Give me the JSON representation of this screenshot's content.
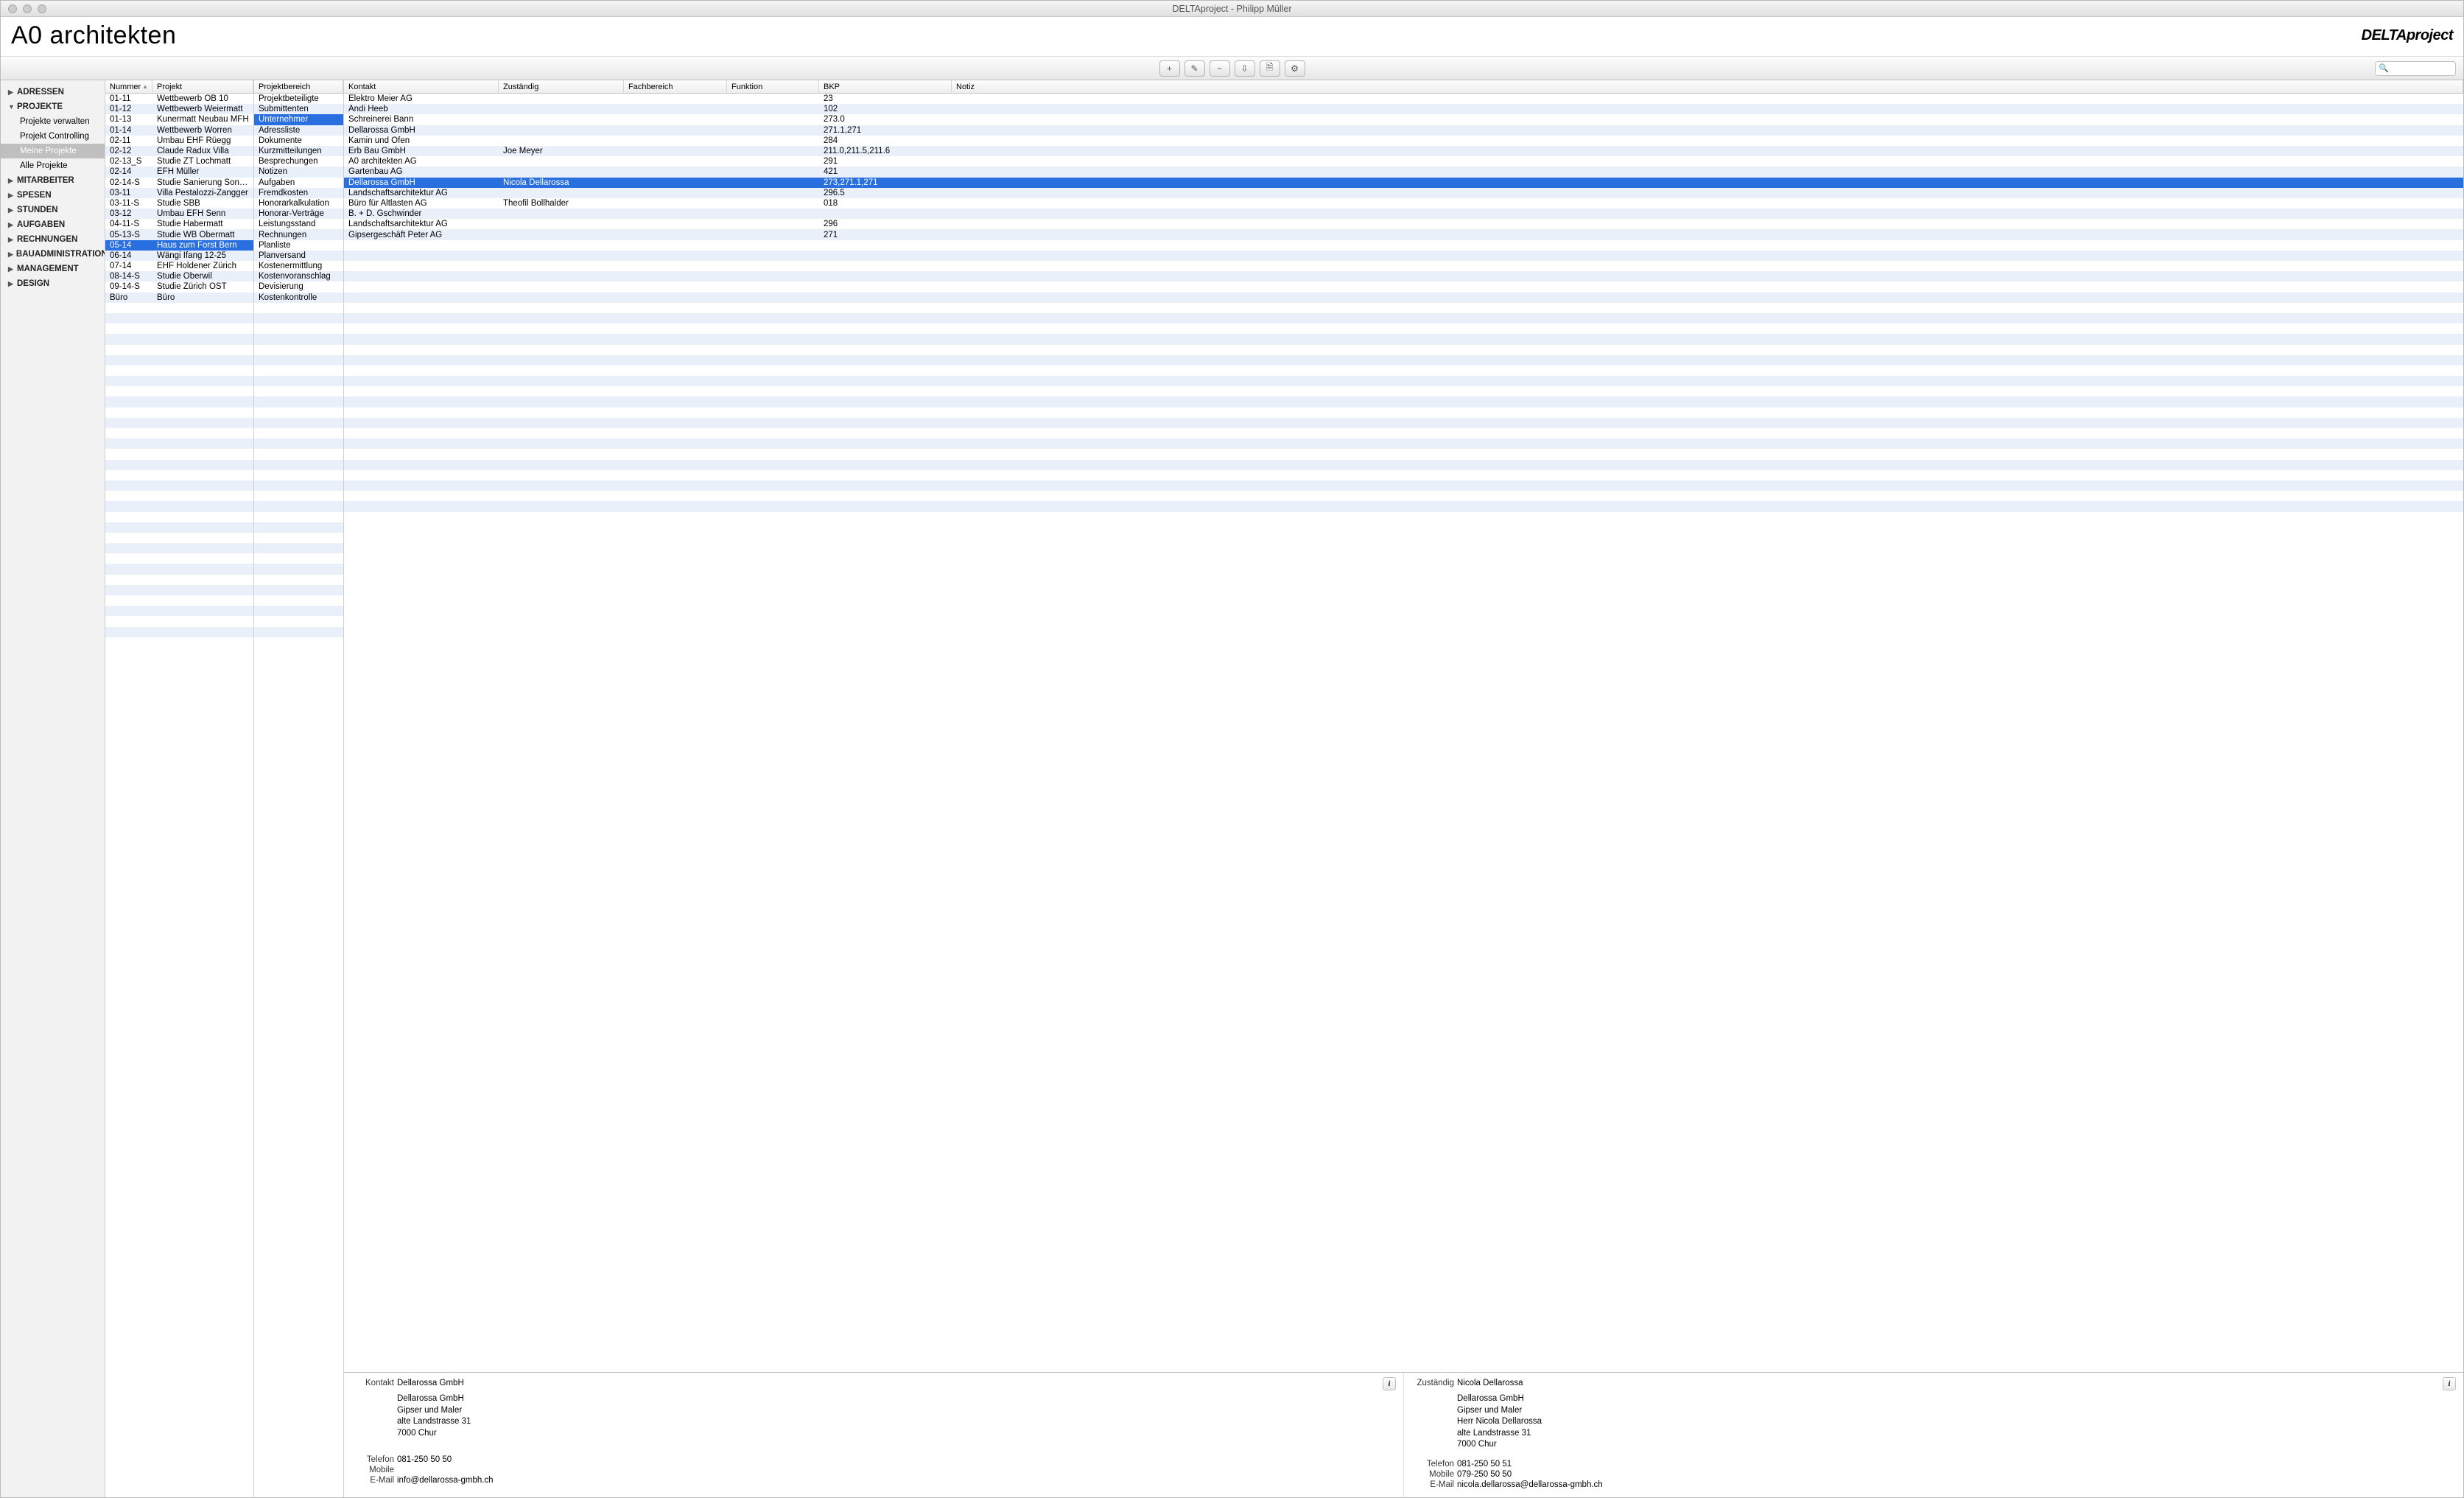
{
  "window_title": "DELTAproject - Philipp Müller",
  "header": {
    "brand": "A0 architekten",
    "logo": "DELTAproject"
  },
  "toolbar_icons": [
    "+",
    "✎",
    "−",
    "⇩",
    "🗎",
    "⚙"
  ],
  "search_placeholder": "",
  "sidebar": [
    {
      "label": "ADRESSEN",
      "open": false
    },
    {
      "label": "PROJEKTE",
      "open": true,
      "children": [
        {
          "label": "Projekte verwalten"
        },
        {
          "label": "Projekt Controlling"
        },
        {
          "label": "Meine Projekte",
          "selected": true
        },
        {
          "label": "Alle Projekte"
        }
      ]
    },
    {
      "label": "MITARBEITER",
      "open": false
    },
    {
      "label": "SPESEN",
      "open": false
    },
    {
      "label": "STUNDEN",
      "open": false
    },
    {
      "label": "AUFGABEN",
      "open": false
    },
    {
      "label": "RECHNUNGEN",
      "open": false
    },
    {
      "label": "BAUADMINISTRATION",
      "open": false
    },
    {
      "label": "MANAGEMENT",
      "open": false
    },
    {
      "label": "DESIGN",
      "open": false
    }
  ],
  "projects": {
    "headers": [
      "Nummer",
      "Projekt"
    ],
    "rows": [
      {
        "n": "01-11",
        "p": "Wettbewerb OB 10"
      },
      {
        "n": "01-12",
        "p": "Wettbewerb Weiermatt"
      },
      {
        "n": "01-13",
        "p": "Kunermatt Neubau MFH"
      },
      {
        "n": "01-14",
        "p": "Wettbewerb Worren"
      },
      {
        "n": "02-11",
        "p": "Umbau EHF Rüegg"
      },
      {
        "n": "02-12",
        "p": "Claude Radux Villa"
      },
      {
        "n": "02-13_S",
        "p": "Studie ZT Lochmatt"
      },
      {
        "n": "02-14",
        "p": "EFH Müller"
      },
      {
        "n": "02-14-S",
        "p": "Studie Sanierung Sonne..."
      },
      {
        "n": "03-11",
        "p": "Villa Pestalozzi-Zangger"
      },
      {
        "n": "03-11-S",
        "p": "Studie SBB"
      },
      {
        "n": "03-12",
        "p": "Umbau EFH Senn"
      },
      {
        "n": "04-11-S",
        "p": "Studie Habermatt"
      },
      {
        "n": "05-13-S",
        "p": "Studie WB Obermatt"
      },
      {
        "n": "05-14",
        "p": "Haus zum Forst Bern",
        "sel": true
      },
      {
        "n": "06-14",
        "p": "Wängi Ifang 12-25"
      },
      {
        "n": "07-14",
        "p": "EHF Holdener Zürich"
      },
      {
        "n": "08-14-S",
        "p": "Studie Oberwil"
      },
      {
        "n": "09-14-S",
        "p": "Studie Zürich OST"
      },
      {
        "n": "Büro",
        "p": "Büro"
      }
    ],
    "blank_rows": 32
  },
  "projbereich": {
    "header": "Projektbereich",
    "rows": [
      "Projektbeteiligte",
      "Submittenten",
      {
        "t": "Unternehmer",
        "sel": true
      },
      "Adressliste",
      "Dokumente",
      "Kurzmitteilungen",
      "Besprechungen",
      "Notizen",
      "Aufgaben",
      "Fremdkosten",
      "Honorarkalkulation",
      "Honorar-Verträge",
      "Leistungsstand",
      "Rechnungen",
      "Planliste",
      "Planversand",
      "Kostenermittlung",
      "Kostenvoranschlag",
      "Devisierung",
      "Kostenkontrolle"
    ],
    "blank_rows": 32
  },
  "contacts": {
    "headers": [
      "Kontakt",
      "Zuständig",
      "Fachbereich",
      "Funktion",
      "BKP",
      "Notiz"
    ],
    "col_widths": [
      "210px",
      "170px",
      "140px",
      "125px",
      "180px",
      "1fr"
    ],
    "rows": [
      {
        "k": "Elektro Meier AG",
        "z": "",
        "f": "",
        "fn": "",
        "b": "23"
      },
      {
        "k": "Andi Heeb",
        "z": "",
        "f": "",
        "fn": "",
        "b": "102"
      },
      {
        "k": "Schreinerei Bann",
        "z": "",
        "f": "",
        "fn": "",
        "b": "273.0"
      },
      {
        "k": "Dellarossa GmbH",
        "z": "",
        "f": "",
        "fn": "",
        "b": "271.1,271"
      },
      {
        "k": "Kamin und Ofen",
        "z": "",
        "f": "",
        "fn": "",
        "b": "284"
      },
      {
        "k": "Erb Bau GmbH",
        "z": "Joe Meyer",
        "f": "",
        "fn": "",
        "b": "211.0,211.5,211.6"
      },
      {
        "k": "A0 architekten AG",
        "z": "",
        "f": "",
        "fn": "",
        "b": "291"
      },
      {
        "k": "Gartenbau AG",
        "z": "",
        "f": "",
        "fn": "",
        "b": "421"
      },
      {
        "k": "Dellarossa GmbH",
        "z": "Nicola Dellarossa",
        "f": "",
        "fn": "",
        "b": "273,271.1,271",
        "sel": true
      },
      {
        "k": "Landschaftsarchitektur AG",
        "z": "",
        "f": "",
        "fn": "",
        "b": "296.5"
      },
      {
        "k": "Büro für Altlasten AG",
        "z": "Theofil Bollhalder",
        "f": "",
        "fn": "",
        "b": "018"
      },
      {
        "k": "B. + D. Gschwinder",
        "z": "",
        "f": "",
        "fn": "",
        "b": ""
      },
      {
        "k": "Landschaftsarchitektur AG",
        "z": "",
        "f": "",
        "fn": "",
        "b": "296"
      },
      {
        "k": "Gipsergeschäft Peter AG",
        "z": "",
        "f": "",
        "fn": "",
        "b": "271"
      }
    ],
    "blank_rows": 26
  },
  "detail": {
    "left": {
      "title_label": "Kontakt",
      "title_value": "Dellarossa GmbH",
      "addr": [
        "Dellarossa GmbH",
        "Gipser und Maler",
        "alte Landstrasse 31",
        "7000 Chur"
      ],
      "fields": [
        {
          "l": "Telefon",
          "v": "081-250 50 50"
        },
        {
          "l": "Mobile",
          "v": ""
        },
        {
          "l": "E-Mail",
          "v": "info@dellarossa-gmbh.ch"
        }
      ]
    },
    "right": {
      "title_label": "Zuständig",
      "title_value": "Nicola Dellarossa",
      "addr": [
        "Dellarossa GmbH",
        "Gipser und Maler",
        "Herr Nicola Dellarossa",
        "alte Landstrasse 31",
        "7000 Chur"
      ],
      "fields": [
        {
          "l": "Telefon",
          "v": "081-250 50 51"
        },
        {
          "l": "Mobile",
          "v": "079-250 50 50"
        },
        {
          "l": "E-Mail",
          "v": "nicola.dellarossa@dellarossa-gmbh.ch"
        }
      ]
    }
  }
}
